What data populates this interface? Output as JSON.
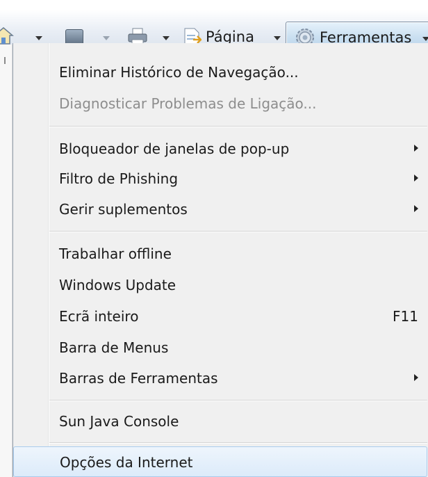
{
  "toolbar": {
    "page_label": "Página",
    "tools_label": "Ferramentas",
    "icons": [
      "home-icon",
      "feed-icon",
      "print-icon",
      "page-icon",
      "gear-icon"
    ]
  },
  "menu": {
    "items": [
      {
        "label": "Eliminar Histórico de Navegação...",
        "enabled": true
      },
      {
        "label": "Diagnosticar Problemas de Ligação...",
        "enabled": false
      },
      {
        "label": "Bloqueador de janelas de pop-up",
        "submenu": true
      },
      {
        "label": "Filtro de Phishing",
        "submenu": true
      },
      {
        "label": "Gerir suplementos",
        "submenu": true
      },
      {
        "label": "Trabalhar offline"
      },
      {
        "label": "Windows Update"
      },
      {
        "label": "Ecrã inteiro",
        "shortcut": "F11"
      },
      {
        "label": "Barra de Menus"
      },
      {
        "label": "Barras de Ferramentas",
        "submenu": true
      },
      {
        "label": "Sun Java Console"
      },
      {
        "label": "Opções da Internet",
        "hovered": true
      }
    ]
  },
  "colors": {
    "menu_background": "#f0f0f0",
    "disabled_text": "#8d8d8d",
    "hover_border": "#a9cbec",
    "tools_button_fill": "#c8def0"
  }
}
